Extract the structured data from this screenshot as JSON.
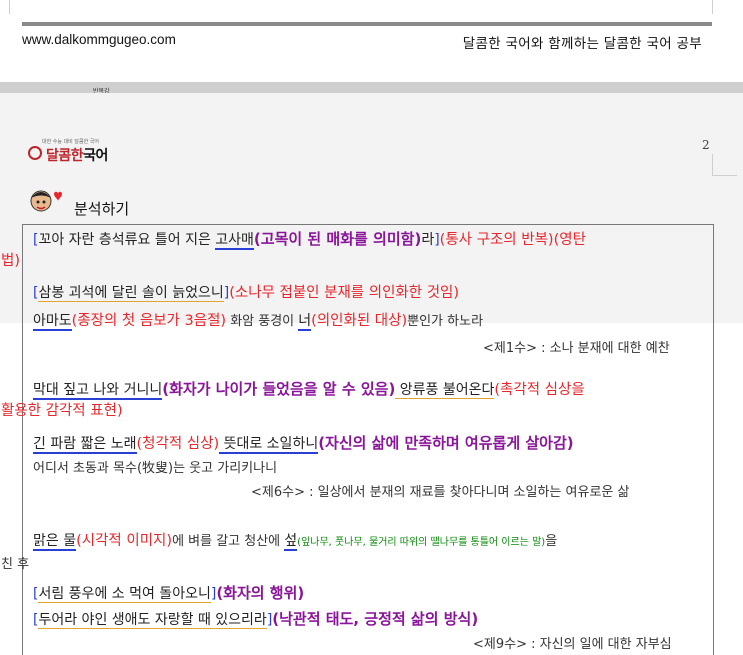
{
  "header": {
    "url": "www.dalkommgugeo.com",
    "slogan": "달콤한 국어와 함께하는 달콤한 국어 공부"
  },
  "tab_label": "반목강",
  "page_number": "2",
  "logo": {
    "small_text": "대한 수능 대비 달콤한 국어",
    "brand_red": "달콤한",
    "brand_black": "국어"
  },
  "section_title": "분석하기",
  "lines": [
    {
      "open": "[",
      "t1": "꼬아 자란 층석류요 틀어 지은 ",
      "t2": "고사매",
      "c1": "(고목이 된 매화를 의미함)",
      "t3": "라",
      "close": "]",
      "c2": "(통사 구조의 반복)(영탄"
    },
    {
      "t1": "법)"
    },
    {
      "open": "[",
      "t1": "삼봉 괴석에 달린 솔이 ",
      "t2": "늙었으니",
      "close": "]",
      "c1": "(소나무 접붙인 분재를 의인화한 것임)"
    },
    {
      "t1": "아마도",
      "c1": "(종장의 첫 음보가 3음절)",
      "t2": " 화암 풍경이 ",
      "t3": "너",
      "c2": "(의인화된 대상)",
      "t4": "뿐인가 하노라"
    },
    {
      "t1": "<제1수> : 소나 분재에 대한 예찬"
    },
    {
      "t1": "막대 짚고 나와 거니니",
      "c1": "(화자가 나이가 들었음을 알 수 있음)",
      "t2": " 앙류풍 불어온다",
      "c2": "(촉각적 심상을"
    },
    {
      "t1": "활용한 감각적 표현)"
    },
    {
      "t1": "긴 파람 짧은 노래",
      "c1": "(청각적 심상)",
      "t2": " 뜻대로 소일하니",
      "c2": "(자신의 삶에 만족하며 여유롭게 살아감)"
    },
    {
      "t1": "어디서 초동과 목수(牧叟)는 웃고 가리키나니"
    },
    {
      "t1": "<제6수> : 일상에서 분재의 재료를 찾아다니며 소일하는 여유로운 삶"
    },
    {
      "t1": "맑은 물",
      "c1": "(시각적 이미지)",
      "t2": "에 벼를 갈고 청산에 ",
      "t3": "섶",
      "g1": "(잎나무, 풋나무, 물거리 따위의 땔나무를 통틀어 이르는 말)",
      "t4": "을"
    },
    {
      "t1": "친 후"
    },
    {
      "open": "[",
      "t1": "서림 풍우에 소 먹여 돌아오니",
      "close": "]",
      "c1": "(화자의 행위)"
    },
    {
      "open": "[",
      "t1": "두어라 야인 생애도 자랑할 때 있으리라",
      "close": "]",
      "c1": "(낙관적 태도, 긍정적 삶의 방식)"
    },
    {
      "t1": "<제9수> : 자신의 일에 대한 자부심"
    }
  ],
  "colors": {
    "red": "#e8272c",
    "purple": "#8a159a",
    "blue": "#2a3fd6",
    "green": "#0c8a0c"
  }
}
